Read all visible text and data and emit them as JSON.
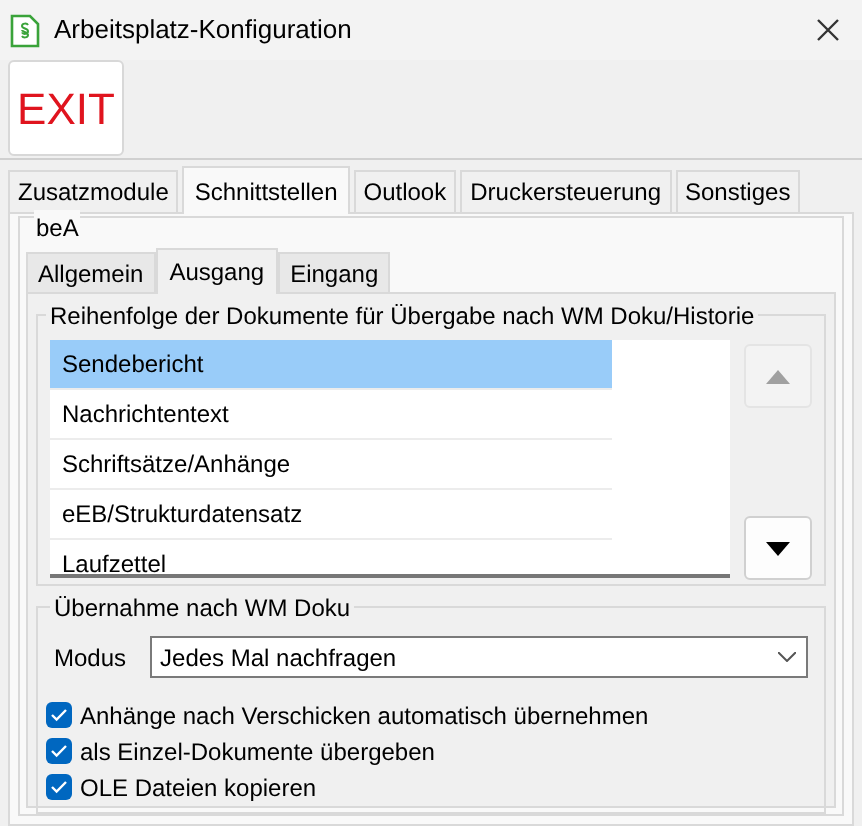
{
  "window": {
    "title": "Arbeitsplatz-Konfiguration"
  },
  "toolbar": {
    "exit_button": "EXIT"
  },
  "tabs": [
    {
      "label": "Zusatzmodule",
      "selected": false
    },
    {
      "label": "Schnittstellen",
      "selected": true
    },
    {
      "label": "Outlook",
      "selected": false
    },
    {
      "label": "Druckersteuerung",
      "selected": false
    },
    {
      "label": "Sonstiges",
      "selected": false
    }
  ],
  "group": {
    "title": "beA"
  },
  "subtabs": [
    {
      "label": "Allgemein",
      "selected": false
    },
    {
      "label": "Ausgang",
      "selected": true
    },
    {
      "label": "Eingang",
      "selected": false
    }
  ],
  "order": {
    "title": "Reihenfolge der Dokumente für Übergabe nach WM Doku/Historie",
    "items": [
      {
        "label": "Sendebericht",
        "selected": true
      },
      {
        "label": "Nachrichtentext",
        "selected": false
      },
      {
        "label": "Schriftsätze/Anhänge",
        "selected": false
      },
      {
        "label": "eEB/Strukturdatensatz",
        "selected": false
      },
      {
        "label": "Laufzettel",
        "selected": false
      }
    ],
    "up_disabled": true,
    "down_disabled": false
  },
  "takeover": {
    "title": "Übernahme nach WM Doku",
    "mode_label": "Modus",
    "mode_value": "Jedes Mal nachfragen",
    "options": [
      {
        "label": "Anhänge nach Verschicken automatisch übernehmen",
        "checked": true
      },
      {
        "label": "als Einzel-Dokumente übergeben",
        "checked": true
      },
      {
        "label": "OLE Dateien kopieren",
        "checked": true
      }
    ]
  }
}
